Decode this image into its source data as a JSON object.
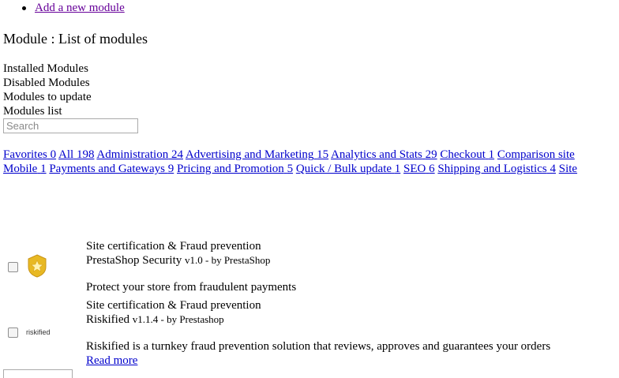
{
  "nav": {
    "add_module_link": "Add a new module"
  },
  "page": {
    "title": "Module : List of modules"
  },
  "views": [
    "Installed Modules",
    "Disabled Modules",
    "Modules to update",
    "Modules list"
  ],
  "search": {
    "placeholder": "Search",
    "value": ""
  },
  "categories": {
    "row1": [
      {
        "label": "Favorites",
        "count": "0"
      },
      {
        "label": "All",
        "count": "198"
      },
      {
        "label": "Administration",
        "count": "24"
      },
      {
        "label": "Advertising and Marketing",
        "count": "15"
      },
      {
        "label": "Analytics and Stats",
        "count": "29"
      },
      {
        "label": "Checkout",
        "count": "1"
      },
      {
        "label": "Comparison site",
        "count": ""
      }
    ],
    "row2": [
      {
        "label": "Mobile",
        "count": "1"
      },
      {
        "label": "Payments and Gateways",
        "count": "9"
      },
      {
        "label": "Pricing and Promotion",
        "count": "5"
      },
      {
        "label": "Quick / Bulk update",
        "count": "1"
      },
      {
        "label": "SEO",
        "count": "6"
      },
      {
        "label": "Shipping and Logistics",
        "count": "4"
      },
      {
        "label": "Site",
        "count": ""
      }
    ]
  },
  "modules": [
    {
      "category": "Site certification & Fraud prevention",
      "name": "PrestaShop Security",
      "meta": "v1.0 - by PrestaShop",
      "description": "Protect your store from fraudulent payments",
      "icon": "gold-star-badge-icon",
      "checked": false
    },
    {
      "category": "Site certification & Fraud prevention",
      "name": "Riskified",
      "meta": "v1.1.4 - by Prestashop",
      "description": "Riskified is a turnkey fraud prevention solution that reviews, approves and guarantees your orders",
      "logo_text": "riskified",
      "read_more": "Read more",
      "checked": false
    }
  ],
  "colors": {
    "link": "#0000cc",
    "visited_link": "#660099",
    "badge_gold": "#e8b923"
  }
}
